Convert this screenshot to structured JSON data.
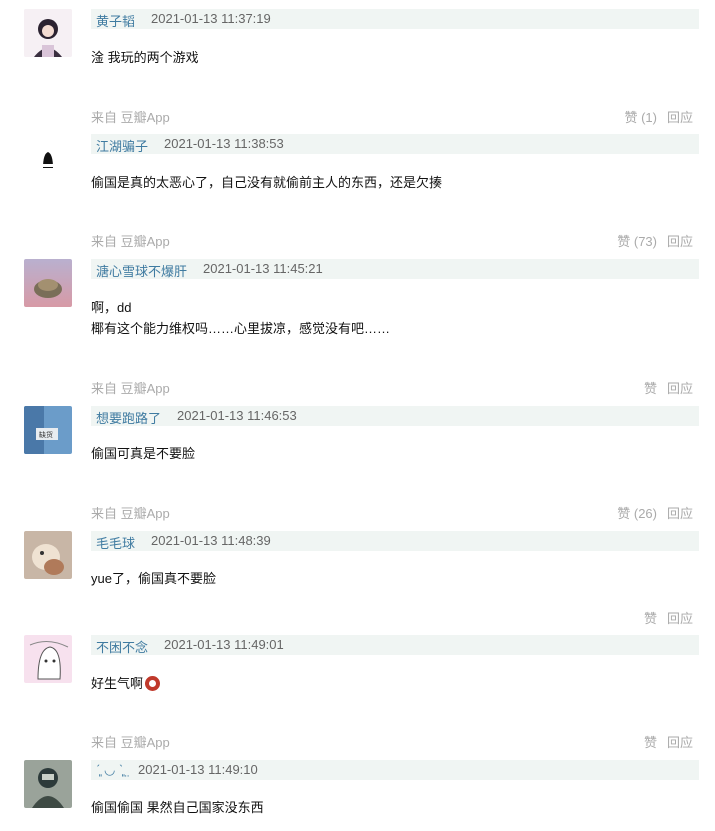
{
  "comments": [
    {
      "author": "黄子韬",
      "time": "2021-01-13 11:37:19",
      "lines": [
        "淦 我玩的两个游戏"
      ],
      "from": "来自 豆瓣App",
      "like": "赞 (1)",
      "reply": "回应"
    },
    {
      "author": "江湖骗子",
      "time": "2021-01-13 11:38:53",
      "lines": [
        "偷国是真的太恶心了，自己没有就偷前主人的东西，还是欠揍"
      ],
      "from": "来自 豆瓣App",
      "like": "赞 (73)",
      "reply": "回应"
    },
    {
      "author": "溏心雪球不爆肝",
      "time": "2021-01-13 11:45:21",
      "lines": [
        "啊，dd",
        "椰有这个能力维权吗……心里拔凉，感觉没有吧……"
      ],
      "from": "来自 豆瓣App",
      "like": "赞",
      "reply": "回应"
    },
    {
      "author": "想要跑路了",
      "time": "2021-01-13 11:46:53",
      "lines": [
        "偷国可真是不要脸"
      ],
      "from": "来自 豆瓣App",
      "like": "赞 (26)",
      "reply": "回应"
    },
    {
      "author": "毛毛球",
      "time": "2021-01-13 11:48:39",
      "lines": [
        "yue了，偷国真不要脸"
      ],
      "from": "",
      "like": "赞",
      "reply": "回应"
    },
    {
      "author": "不困不念",
      "time": "2021-01-13 11:49:01",
      "lines": [
        "好生气啊"
      ],
      "from": "来自 豆瓣App",
      "like": "赞",
      "reply": "回应"
    },
    {
      "author": "ˊ͈ ◡ ˋ͈ ̤",
      "time": "2021-01-13 11:49:10",
      "lines": [
        "偷国偷国 果然自己国家没东西"
      ],
      "from": "",
      "like": "",
      "reply": ""
    }
  ],
  "avatar_colors": [
    "#e9d8e4",
    "#ffffff",
    "#a7a2b8",
    "#5b7fa6",
    "#c9a38a",
    "#f4d3e6",
    "#6f7a6a"
  ],
  "icons": {
    "angry_emoji": "angry-emoji-icon"
  }
}
